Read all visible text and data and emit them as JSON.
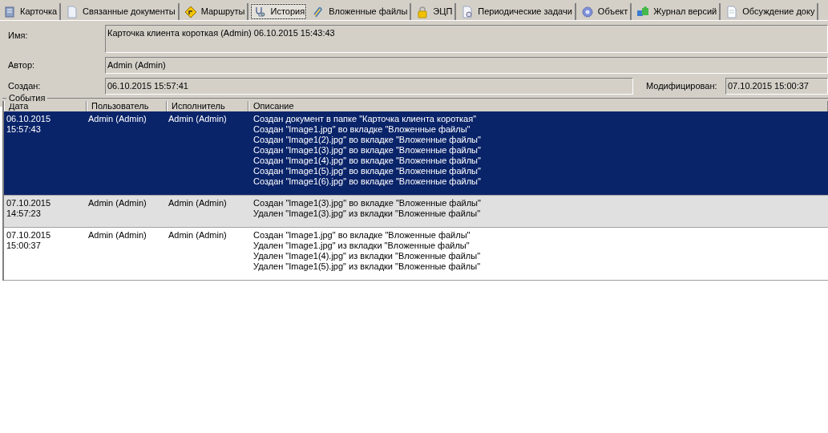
{
  "tabs": [
    {
      "label": "Карточка",
      "selected": false
    },
    {
      "label": "Связанные документы",
      "selected": false
    },
    {
      "label": "Маршруты",
      "selected": false
    },
    {
      "label": "История",
      "selected": true
    },
    {
      "label": "Вложенные файлы",
      "selected": false
    },
    {
      "label": "ЭЦП",
      "selected": false
    },
    {
      "label": "Периодические задачи",
      "selected": false
    },
    {
      "label": "Объект",
      "selected": false
    },
    {
      "label": "Журнал версий",
      "selected": false
    },
    {
      "label": "Обсуждение доку",
      "selected": false
    }
  ],
  "form": {
    "name_label": "Имя:",
    "name_value": "Карточка клиента короткая (Admin) 06.10.2015 15:43:43",
    "author_label": "Автор:",
    "author_value": "Admin (Admin)",
    "created_label": "Создан:",
    "created_value": "06.10.2015 15:57:41",
    "modified_label": "Модифицирован:",
    "modified_value": "07.10.2015 15:00:37"
  },
  "events": {
    "title": "События",
    "columns": [
      "Дата",
      "Пользователь",
      "Исполнитель",
      "Описание"
    ],
    "rows": [
      {
        "selected": true,
        "date": [
          "06.10.2015",
          "15:57:43"
        ],
        "user": "Admin (Admin)",
        "executor": "Admin (Admin)",
        "description": [
          "Создан документ в папке \"Карточка клиента короткая\"",
          "Создан \"Image1.jpg\" во вкладке \"Вложенные файлы\"",
          "Создан \"Image1(2).jpg\" во вкладке \"Вложенные файлы\"",
          "Создан \"Image1(3).jpg\" во вкладке \"Вложенные файлы\"",
          "Создан \"Image1(4).jpg\" во вкладке \"Вложенные файлы\"",
          "Создан \"Image1(5).jpg\" во вкладке \"Вложенные файлы\"",
          "Создан \"Image1(6).jpg\" во вкладке \"Вложенные файлы\""
        ]
      },
      {
        "selected": false,
        "date": [
          "07.10.2015",
          "14:57:23"
        ],
        "user": "Admin (Admin)",
        "executor": "Admin (Admin)",
        "description": [
          "Создан \"Image1(3).jpg\" во вкладке \"Вложенные файлы\"",
          "Удален \"Image1(3).jpg\" из вкладки \"Вложенные файлы\""
        ]
      },
      {
        "selected": false,
        "date": [
          "07.10.2015",
          "15:00:37"
        ],
        "user": "Admin (Admin)",
        "executor": "Admin (Admin)",
        "description": [
          "Создан \"Image1.jpg\" во вкладке \"Вложенные файлы\"",
          "Удален \"Image1.jpg\" из вкладки \"Вложенные файлы\"",
          "Удален \"Image1(4).jpg\" из вкладки \"Вложенные файлы\"",
          "Удален \"Image1(5).jpg\" из вкладки \"Вложенные файлы\""
        ]
      }
    ]
  }
}
